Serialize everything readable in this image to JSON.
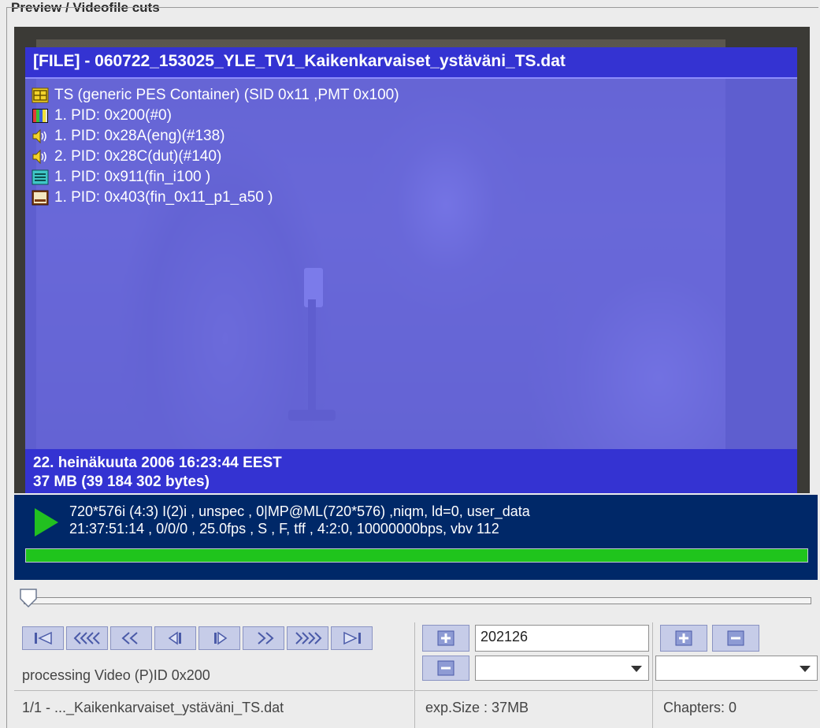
{
  "group_title": "Preview / Videofile cuts",
  "overlay": {
    "file_title": "[FILE] - 060722_153025_YLE_TV1_Kaikenkarvaiset_ystäväni_TS.dat",
    "streams": [
      {
        "icon": "container-icon",
        "text": "TS (generic PES Container) (SID 0x11 ,PMT 0x100)"
      },
      {
        "icon": "video-stream-icon",
        "text": "1. PID: 0x200(#0)"
      },
      {
        "icon": "audio-stream-icon",
        "text": "1. PID: 0x28A(eng)(#138)"
      },
      {
        "icon": "audio-stream-icon",
        "text": "2. PID: 0x28C(dut)(#140)"
      },
      {
        "icon": "teletext-icon",
        "text": "1. PID: 0x911(fin_i100 )"
      },
      {
        "icon": "subtitle-icon",
        "text": "1. PID: 0x403(fin_0x11_p1_a50 )"
      }
    ],
    "date": "22. heinäkuuta 2006  16:23:44 EEST",
    "size": "37 MB (39 184 302 bytes)"
  },
  "status": {
    "line1": "720*576i (4:3) I(2)i , unspec , 0|MP@ML(720*576)  ,niqm, ld=0, user_data",
    "line2": "21:37:51:14 , 0/0/0 , 25.0fps , S , F, tff , 4:2:0, 10000000bps, vbv 112",
    "progress": 1.0
  },
  "slider": {
    "position": 0.0
  },
  "nav_buttons": [
    "first-icon",
    "rewind-fast-icon",
    "rewind-icon",
    "step-back-icon",
    "step-forward-icon",
    "forward-icon",
    "forward-fast-icon",
    "last-icon"
  ],
  "left_panel": {
    "processing": "processing Video (P)ID 0x200",
    "file_info": "1/1 - ..._Kaikenkarvaiset_ystäväni_TS.dat"
  },
  "cut_panel": {
    "cut_value": "202126",
    "exp_size": "exp.Size : 37MB"
  },
  "chapter_panel": {
    "chapters": "Chapters:  0"
  },
  "colors": {
    "overlay": "#6868f6",
    "header": "#3433d2",
    "status_bg": "#002868",
    "progress": "#1fc41c"
  }
}
